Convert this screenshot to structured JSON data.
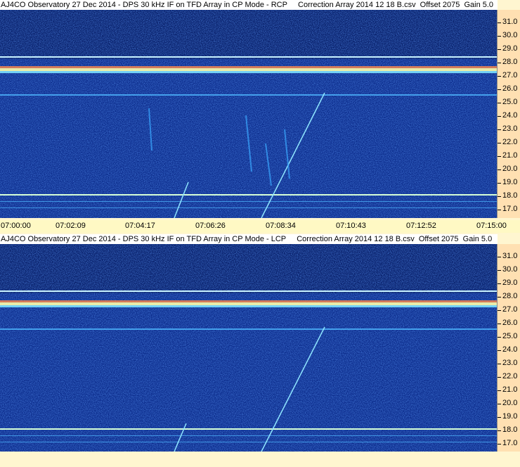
{
  "panels": [
    {
      "title": "AJ4CO Observatory 27 Dec 2014 - DPS 30 kHz IF on TFD Array in CP Mode - RCP     Correction Array 2014 12 18 B.csv  Offset 2075  Gain 5.0",
      "y_ticks": [
        "31.0",
        "30.0",
        "29.0",
        "28.0",
        "27.0",
        "26.0",
        "25.0",
        "24.0",
        "23.0",
        "22.0",
        "21.0",
        "20.0",
        "19.0",
        "18.0",
        "17.0"
      ],
      "x_ticks": [
        "07:00:00",
        "07:02:09",
        "07:04:17",
        "07:06:26",
        "07:08:34",
        "07:10:43",
        "07:12:52",
        "07:15:00"
      ]
    },
    {
      "title": "AJ4CO Observatory 27 Dec 2014 - DPS 30 kHz IF on TFD Array in CP Mode - LCP     Correction Array 2014 12 18 B.csv  Offset 2075  Gain 5.0",
      "y_ticks": [
        "31.0",
        "30.0",
        "29.0",
        "28.0",
        "27.0",
        "26.0",
        "25.0",
        "24.0",
        "23.0",
        "22.0",
        "21.0",
        "20.0",
        "19.0",
        "18.0",
        "17.0"
      ],
      "x_ticks": []
    }
  ],
  "colors": {
    "background": "#0a2a8a",
    "axis_bg": "#ffe0b2",
    "time_bar": "#fff9c4"
  }
}
